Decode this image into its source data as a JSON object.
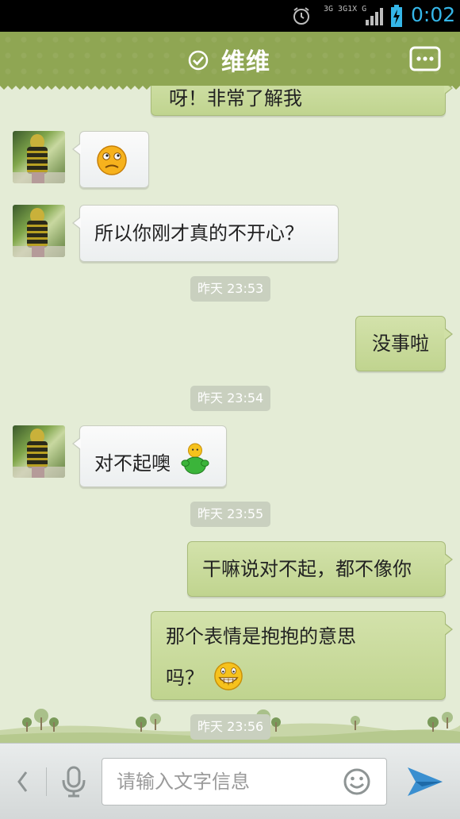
{
  "status_bar": {
    "network_label_top": "3G 3G1X G",
    "time": "0:02",
    "accent_color": "#35b6e8"
  },
  "header": {
    "title": "维维",
    "background_color": "#8fa653"
  },
  "messages": [
    {
      "side": "right",
      "type": "text",
      "text": "呀！非常了解我",
      "partial": true
    },
    {
      "side": "left",
      "type": "emoji",
      "emoji": "confused-face"
    },
    {
      "side": "left",
      "type": "text",
      "text": "所以你刚才真的不开心？"
    },
    {
      "type": "timestamp",
      "text": "昨天 23:53"
    },
    {
      "side": "right",
      "type": "text",
      "text": "没事啦"
    },
    {
      "type": "timestamp",
      "text": "昨天 23:54"
    },
    {
      "side": "left",
      "type": "text",
      "text": "对不起噢",
      "emoji": "hug-figure"
    },
    {
      "type": "timestamp",
      "text": "昨天 23:55"
    },
    {
      "side": "right",
      "type": "text",
      "text": "干嘛说对不起，都不像你"
    },
    {
      "side": "right",
      "type": "text",
      "lines": [
        "那个表情是抱抱的意思",
        "吗？"
      ],
      "emoji": "grin-face"
    },
    {
      "type": "timestamp",
      "text": "昨天 23:56"
    }
  ],
  "input_bar": {
    "placeholder": "请输入文字信息"
  }
}
